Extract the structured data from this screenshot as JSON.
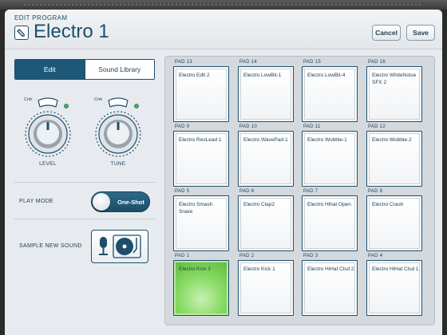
{
  "header": {
    "subtitle": "EDIT PROGRAM",
    "title": "Electro 1",
    "cancel_label": "Cancel",
    "save_label": "Save",
    "edit_icon": "pencil-icon"
  },
  "tabs": {
    "edit_label": "Edit",
    "sound_library_label": "Sound Library",
    "active": "Edit"
  },
  "knobs": {
    "level": {
      "label": "LEVEL",
      "cntr": "Cntr"
    },
    "tune": {
      "label": "TUNE",
      "cntr": "Cntr"
    }
  },
  "play_mode": {
    "label": "PLAY MODE",
    "value": "One-Shot"
  },
  "sample": {
    "label": "SAMPLE NEW SOUND",
    "icons": [
      "microphone-icon",
      "turntable-icon"
    ]
  },
  "colors": {
    "accent": "#1e5878",
    "selected_pad": "#5cbb3c"
  },
  "pads": [
    {
      "num": "PAD 13",
      "name": "Electro Edit 2"
    },
    {
      "num": "PAD 14",
      "name": "Electro LowBit-1"
    },
    {
      "num": "PAD 15",
      "name": "Electro LowBit-4"
    },
    {
      "num": "PAD 16",
      "name": "Electro WhiteNoise SFX 2"
    },
    {
      "num": "PAD 9",
      "name": "Electro RevLead 1"
    },
    {
      "num": "PAD 10",
      "name": "Electro WavePad-1"
    },
    {
      "num": "PAD 11",
      "name": "Electro Wobble-1"
    },
    {
      "num": "PAD 12",
      "name": "Electro Wobble-2"
    },
    {
      "num": "PAD 5",
      "name": "Electro Smash Snare"
    },
    {
      "num": "PAD 6",
      "name": "Electro Clap2"
    },
    {
      "num": "PAD 7",
      "name": "Electro Hihat Open"
    },
    {
      "num": "PAD 8",
      "name": "Electro Crash"
    },
    {
      "num": "PAD 1",
      "name": "Electro Kick 3",
      "selected": true
    },
    {
      "num": "PAD 2",
      "name": "Electro Kick 1"
    },
    {
      "num": "PAD 3",
      "name": "Electro HiHat Clsd 2"
    },
    {
      "num": "PAD 4",
      "name": "Electro HiHat Clsd 1"
    }
  ]
}
